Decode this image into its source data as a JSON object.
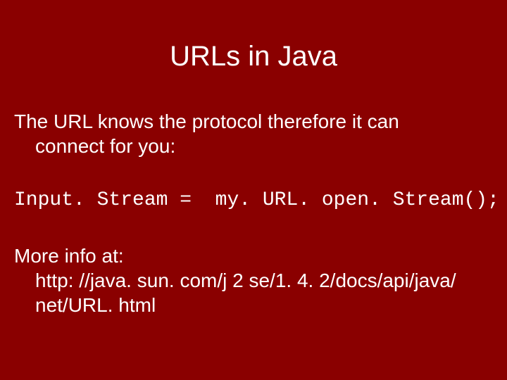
{
  "slide": {
    "title": "URLs in Java",
    "intro_line1": "The URL knows the protocol therefore it can",
    "intro_line2": "connect for you:",
    "code": "Input. Stream =  my. URL. open. Stream();",
    "more_label": "More info at:",
    "more_url_line1": "http: //java. sun. com/j 2 se/1. 4. 2/docs/api/java/",
    "more_url_line2": "net/URL. html"
  }
}
